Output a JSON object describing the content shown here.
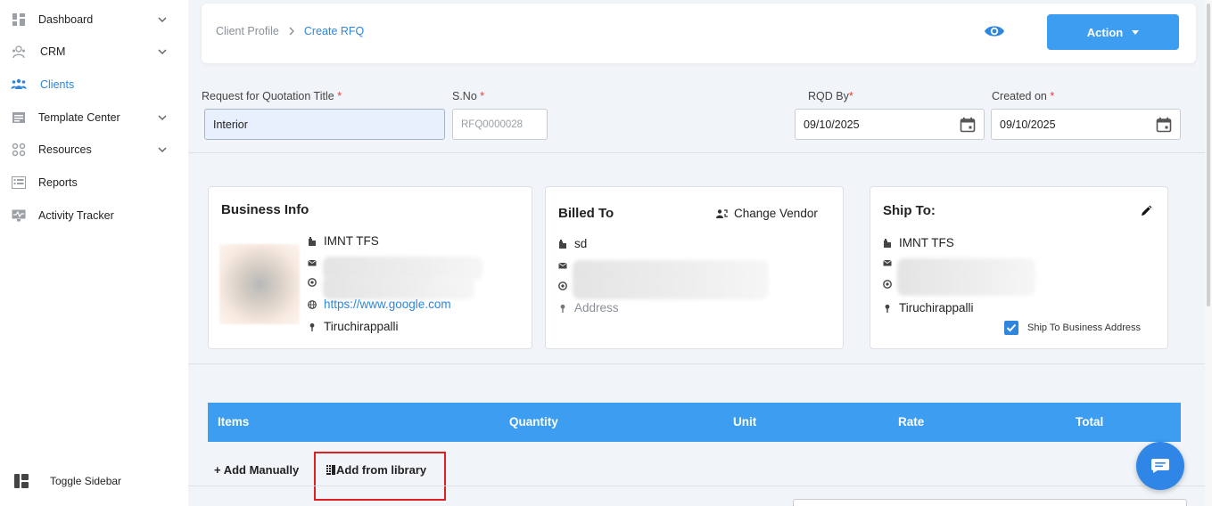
{
  "sidebar": {
    "items": [
      {
        "label": "Dashboard",
        "icon": "grid-icon",
        "has_chevron": true
      },
      {
        "label": "CRM",
        "icon": "crm-icon",
        "has_chevron": true
      },
      {
        "label": "Clients",
        "icon": "users-icon",
        "has_chevron": false,
        "active": true
      },
      {
        "label": "Template Center",
        "icon": "template-icon",
        "has_chevron": true
      },
      {
        "label": "Resources",
        "icon": "resources-icon",
        "has_chevron": true
      },
      {
        "label": "Reports",
        "icon": "reports-icon",
        "has_chevron": false
      },
      {
        "label": "Activity Tracker",
        "icon": "activity-icon",
        "has_chevron": false
      }
    ],
    "toggle_label": "Toggle Sidebar"
  },
  "header": {
    "breadcrumb": [
      "Client Profile",
      "Create RFQ"
    ],
    "action_label": "Action"
  },
  "form": {
    "title_label": "Request for Quotation Title",
    "title_value": "Interior",
    "sno_label": "S.No",
    "sno_placeholder": "RFQ0000028",
    "rqd_label": "RQD By",
    "rqd_value": "09/10/2025",
    "created_label": "Created on",
    "created_value": "09/10/2025",
    "required_mark": "*"
  },
  "business_info": {
    "title": "Business Info",
    "name": "IMNT TFS",
    "website": "https://www.google.com",
    "city": "Tiruchirappalli"
  },
  "billed_to": {
    "title": "Billed To",
    "change_vendor_label": "Change Vendor",
    "name": "sd",
    "address_placeholder": "Address"
  },
  "ship_to": {
    "title": "Ship To:",
    "name": "IMNT TFS",
    "city": "Tiruchirappalli",
    "checkbox_label": "Ship To Business Address",
    "checkbox_checked": true
  },
  "items_table": {
    "columns": [
      "Items",
      "Quantity",
      "Unit",
      "Rate",
      "Total"
    ]
  },
  "actions": {
    "add_manually": "+ Add Manually",
    "add_from_library": "Add from library"
  },
  "colors": {
    "primary": "#3d9df0",
    "link": "#2e86de",
    "highlight": "#e02020"
  }
}
